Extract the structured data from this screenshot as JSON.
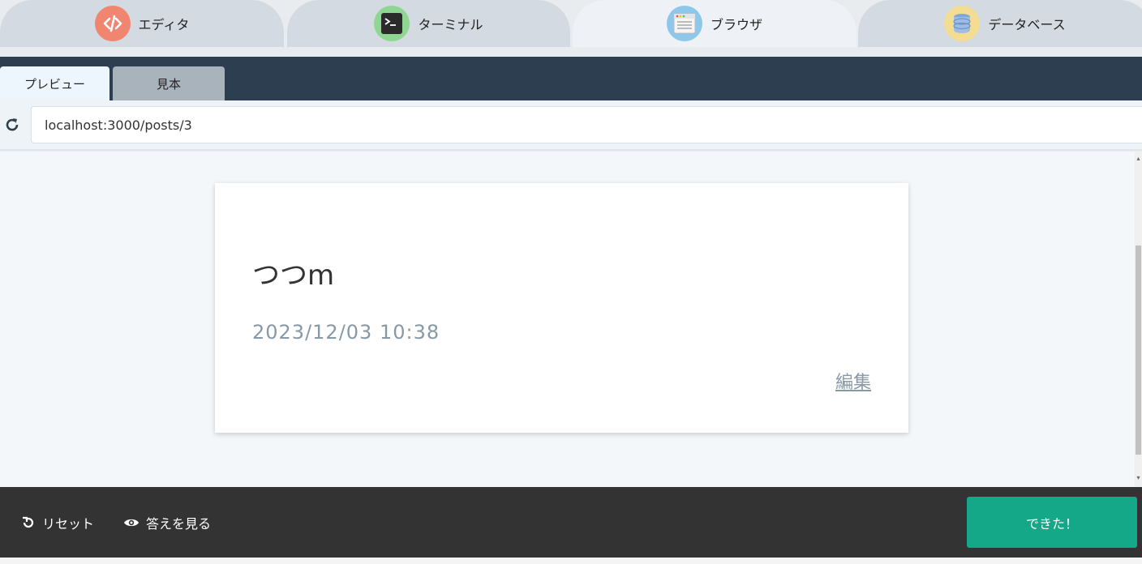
{
  "tool_tabs": [
    {
      "label": "エディタ",
      "icon": "code-icon"
    },
    {
      "label": "ターミナル",
      "icon": "terminal-icon"
    },
    {
      "label": "ブラウザ",
      "icon": "browser-window-icon"
    },
    {
      "label": "データベース",
      "icon": "database-icon"
    }
  ],
  "view_tabs": {
    "preview": "プレビュー",
    "sample": "見本"
  },
  "address": {
    "url": "localhost:3000/posts/3"
  },
  "post": {
    "content": "つつm",
    "created_at": "2023/12/03 10:38",
    "edit_label": "編集"
  },
  "bottom": {
    "reset_label": "リセット",
    "answer_label": "答えを見る",
    "done_label": "できた！"
  },
  "colors": {
    "editor_icon": "#f08570",
    "terminal_icon": "#8fd693",
    "browser_icon": "#8dc8ea",
    "database_icon": "#f3dd92",
    "header": "#2c3e50",
    "done_button": "#14a889",
    "bottom_bar": "#333333"
  }
}
